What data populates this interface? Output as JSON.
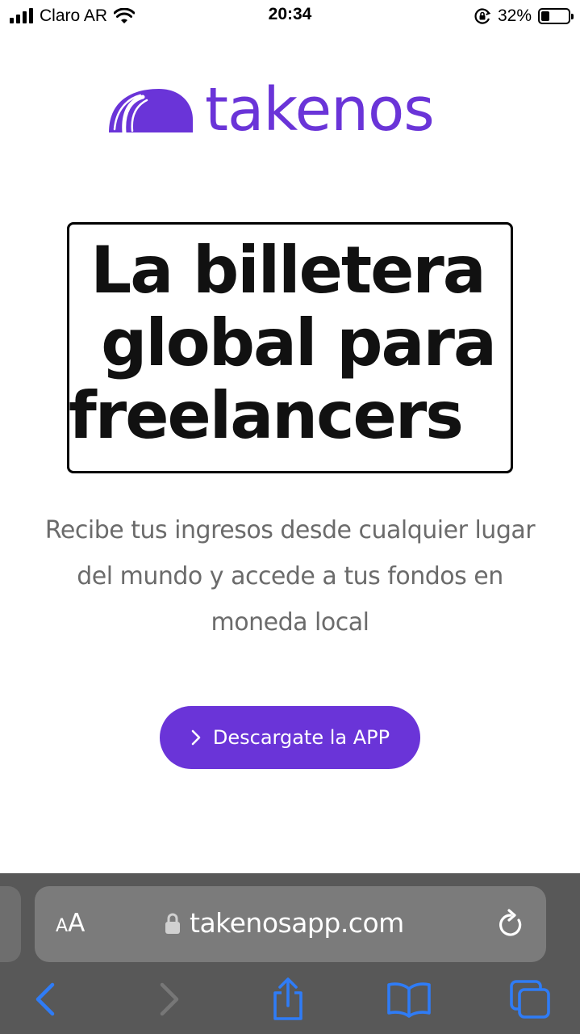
{
  "status_bar": {
    "carrier": "Claro AR",
    "time": "20:34",
    "battery_percent": "32%",
    "battery_level": 0.32
  },
  "logo": {
    "brand": "takenos",
    "color": "#6a34d8"
  },
  "hero": {
    "headline_line1": "La billetera",
    "headline_line2": "global para",
    "headline_line3": "freelancers",
    "subtitle_line1": "Recibe tus ingresos desde cualquier lugar",
    "subtitle_line2": "del mundo y accede a tus fondos en",
    "subtitle_line3": "moneda local"
  },
  "cta": {
    "label": "Descargate la APP",
    "icon": "chevron-right-icon",
    "color": "#6a34d8"
  },
  "safari": {
    "text_size_label_small": "A",
    "text_size_label_big": "A",
    "url": "takenosapp.com",
    "accent": "#2f7cf6",
    "icons": [
      "back-icon",
      "forward-icon",
      "share-icon",
      "bookmarks-icon",
      "tabs-icon",
      "lock-icon",
      "reload-icon"
    ]
  }
}
